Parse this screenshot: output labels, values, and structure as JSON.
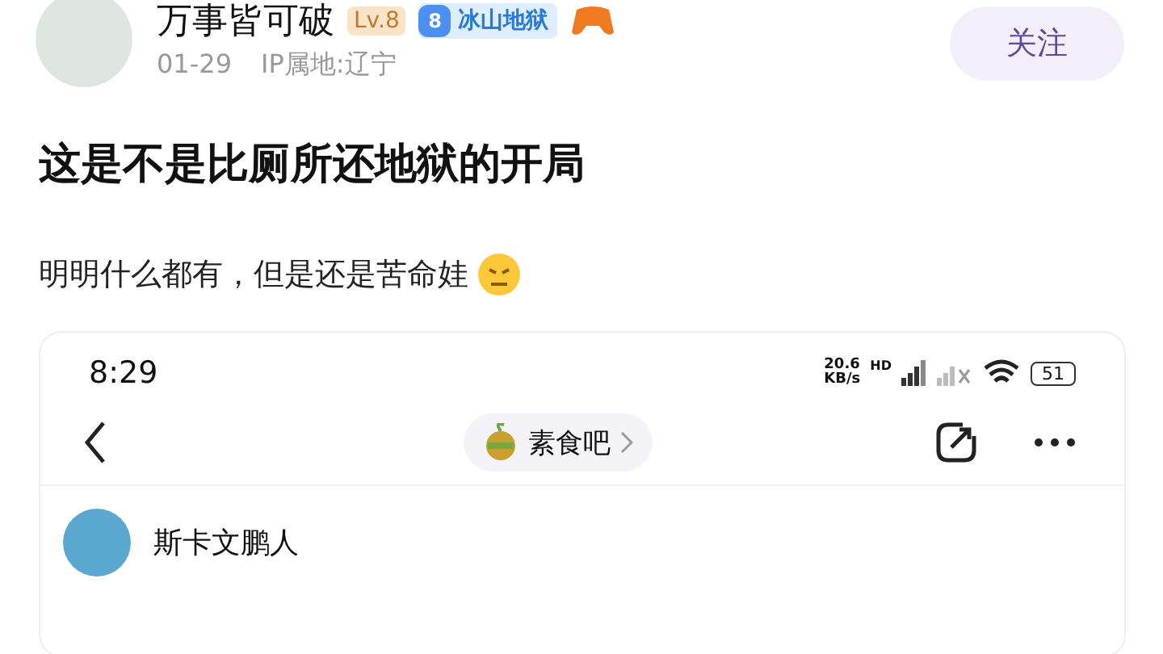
{
  "post": {
    "author": {
      "name": "万事皆可破",
      "level_badge": "Lv.8",
      "tier_badge": {
        "number": "8",
        "label": "冰山地狱"
      }
    },
    "date": "01-29",
    "ip_location": "IP属地:辽宁",
    "follow_button": "关注",
    "title": "这是不是比厕所还地狱的开局",
    "body": "明明什么都有，但是还是苦命娃"
  },
  "screenshot": {
    "status_bar": {
      "time": "8:29",
      "speed": "20.6",
      "speed_unit": "KB/s",
      "network": "HD",
      "battery": "51"
    },
    "nav": {
      "forum": "素食吧"
    },
    "reply": {
      "author": "斯卡文鹏人"
    }
  }
}
